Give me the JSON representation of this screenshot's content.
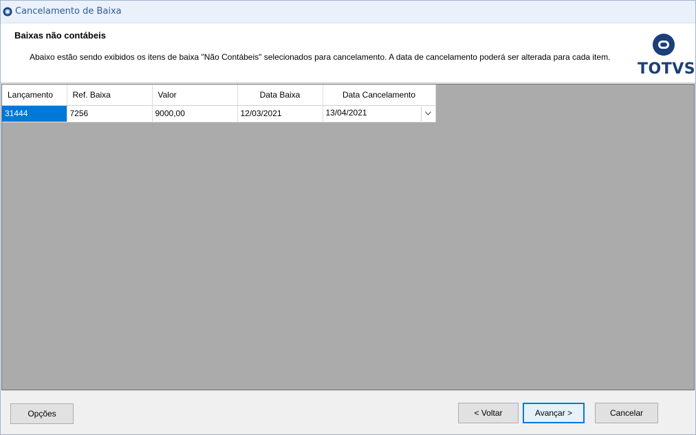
{
  "window": {
    "title": "Cancelamento de Baixa"
  },
  "header": {
    "title": "Baixas não contábeis",
    "description": "Abaixo estão sendo exibidos os itens de baixa \"Não Contábeis\" selecionados para cancelamento. A data de cancelamento poderá ser alterada para cada item.",
    "logo_text": "TOTVS"
  },
  "grid": {
    "columns": [
      "Lançamento",
      "Ref. Baixa",
      "Valor",
      "Data Baixa",
      "Data Cancelamento"
    ],
    "rows": [
      {
        "lancamento": "31444",
        "ref_baixa": "7256",
        "valor": "9000,00",
        "data_baixa": "12/03/2021",
        "data_cancelamento": "13/04/2021"
      }
    ]
  },
  "footer": {
    "options_label": "Opções",
    "back_label": "< Voltar",
    "next_label": "Avançar >",
    "cancel_label": "Cancelar"
  },
  "colors": {
    "accent": "#0078d7",
    "title_text": "#2d5b9a",
    "logo_blue": "#1b3f78",
    "grid_background": "#ababab"
  }
}
